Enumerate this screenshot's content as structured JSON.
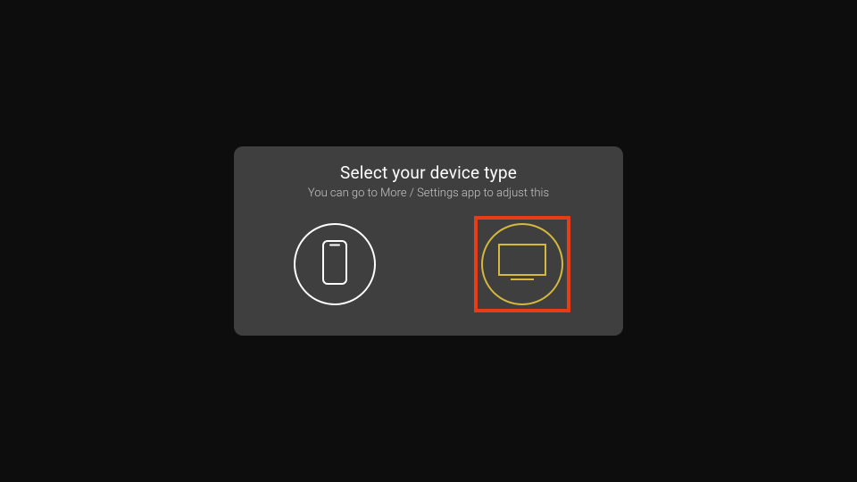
{
  "dialog": {
    "title": "Select your device type",
    "subtitle": "You can go to More / Settings app to adjust this"
  },
  "options": {
    "phone": {
      "label": "phone",
      "selected": false
    },
    "tv": {
      "label": "tv",
      "selected": true
    }
  },
  "colors": {
    "accent": "#d4b93e",
    "highlight": "#e83c16"
  }
}
